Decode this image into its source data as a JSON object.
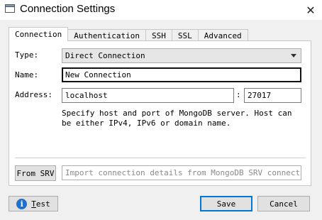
{
  "window": {
    "title": "Connection Settings",
    "close_glyph": "✕",
    "app_icon": "window-icon"
  },
  "tabs": [
    {
      "label": "Connection",
      "active": true
    },
    {
      "label": "Authentication",
      "active": false
    },
    {
      "label": "SSH",
      "active": false
    },
    {
      "label": "SSL",
      "active": false
    },
    {
      "label": "Advanced",
      "active": false
    }
  ],
  "form": {
    "type_label": "Type:",
    "type_value": "Direct Connection",
    "name_label": "Name:",
    "name_value": "New Connection",
    "address_label": "Address:",
    "host_value": "localhost",
    "port_separator": ":",
    "port_value": "27017",
    "help_text": "Specify host and port of MongoDB server. Host can be either IPv4, IPv6 or domain name.",
    "from_srv_label": "From SRV",
    "srv_placeholder": "Import connection details from MongoDB SRV connection string"
  },
  "footer": {
    "test_label_first": "T",
    "test_label_rest": "est",
    "test_icon": "info-icon",
    "info_glyph": "i",
    "save_label": "Save",
    "cancel_label": "Cancel"
  },
  "colors": {
    "accent": "#0078d7",
    "info_icon": "#1e6fd0"
  }
}
